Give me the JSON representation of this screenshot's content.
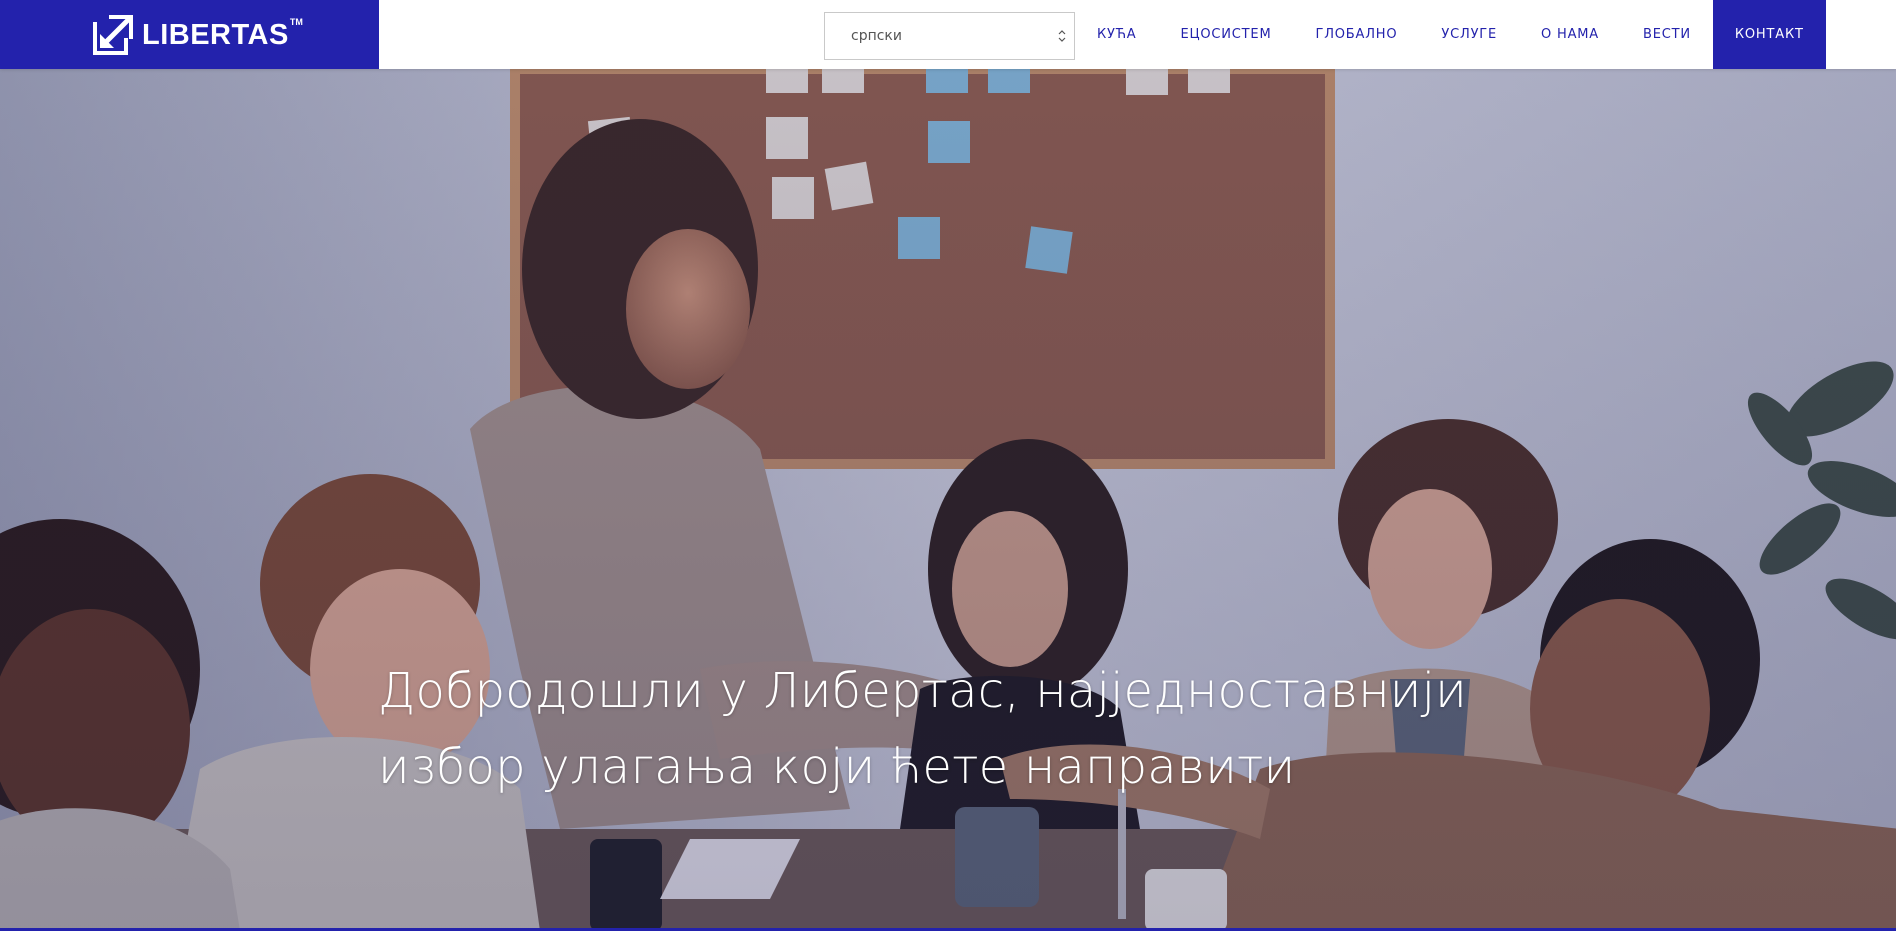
{
  "brand": {
    "name": "LIBERTAS",
    "trademark": "TM",
    "color": "#2322ac",
    "icon": "arrow-up-right-box-icon"
  },
  "language_select": {
    "selected": "српски",
    "icon": "chevron-up-down-icon"
  },
  "nav": {
    "items": [
      {
        "label": "КУЋА"
      },
      {
        "label": "ЕЦОСИСТЕМ"
      },
      {
        "label": "ГЛОБАЛНО"
      },
      {
        "label": "УСЛУГЕ"
      },
      {
        "label": "О НАМА"
      },
      {
        "label": "ВЕСТИ"
      },
      {
        "label": "КОНТАКТ",
        "active": true
      }
    ]
  },
  "hero": {
    "title": "Добродошли у Либертас, најједноставнији избор улагања који ћете направити"
  }
}
